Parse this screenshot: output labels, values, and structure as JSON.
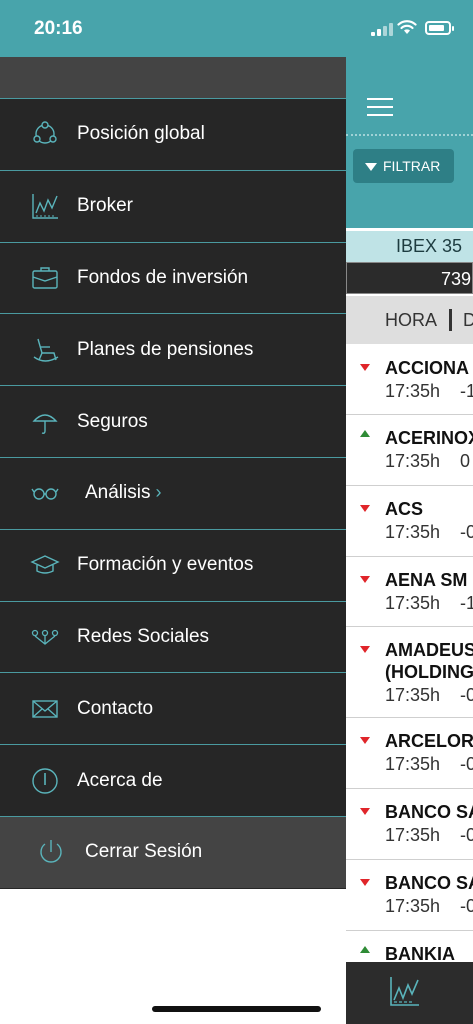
{
  "status": {
    "time": "20:16"
  },
  "app": {
    "filter_label": "FILTRAR",
    "index_name": "IBEX 35",
    "index_value": "739",
    "columns": [
      "HORA",
      "D"
    ],
    "rows": [
      {
        "name": "ACCIONA",
        "time": "17:35h",
        "change": "-1",
        "trend": "down"
      },
      {
        "name": "ACERINOX",
        "time": "17:35h",
        "change": "0",
        "trend": "up"
      },
      {
        "name": "ACS",
        "time": "17:35h",
        "change": "-0",
        "trend": "down"
      },
      {
        "name": "AENA SM",
        "time": "17:35h",
        "change": "-1",
        "trend": "down"
      },
      {
        "name": "AMADEUS\n(HOLDING",
        "time": "17:35h",
        "change": "-0",
        "trend": "down"
      },
      {
        "name": "ARCELOR",
        "time": "17:35h",
        "change": "-0",
        "trend": "down"
      },
      {
        "name": "BANCO SA",
        "time": "17:35h",
        "change": "-0",
        "trend": "down"
      },
      {
        "name": "BANCO SA",
        "time": "17:35h",
        "change": "-0",
        "trend": "down"
      },
      {
        "name": "BANKIA",
        "time": "",
        "change": "",
        "trend": "up"
      }
    ]
  },
  "drawer": {
    "items": [
      {
        "label": "Posición global",
        "icon": "network-icon"
      },
      {
        "label": "Broker",
        "icon": "chart-icon"
      },
      {
        "label": "Fondos de inversión",
        "icon": "briefcase-icon"
      },
      {
        "label": "Planes de pensiones",
        "icon": "rocking-chair-icon"
      },
      {
        "label": "Seguros",
        "icon": "umbrella-icon"
      },
      {
        "label": "Análisis",
        "icon": "glasses-icon"
      },
      {
        "label": "Formación y eventos",
        "icon": "graduation-cap-icon"
      },
      {
        "label": "Redes Sociales",
        "icon": "social-icon"
      },
      {
        "label": "Contacto",
        "icon": "envelope-icon"
      },
      {
        "label": "Acerca de",
        "icon": "info-icon"
      }
    ],
    "logout_label": "Cerrar Sesión"
  },
  "colors": {
    "accent": "#48a4ab",
    "drawer_bg": "#262626",
    "icon": "#5ab4bb",
    "down": "#e0252a",
    "up": "#2e8b35"
  }
}
